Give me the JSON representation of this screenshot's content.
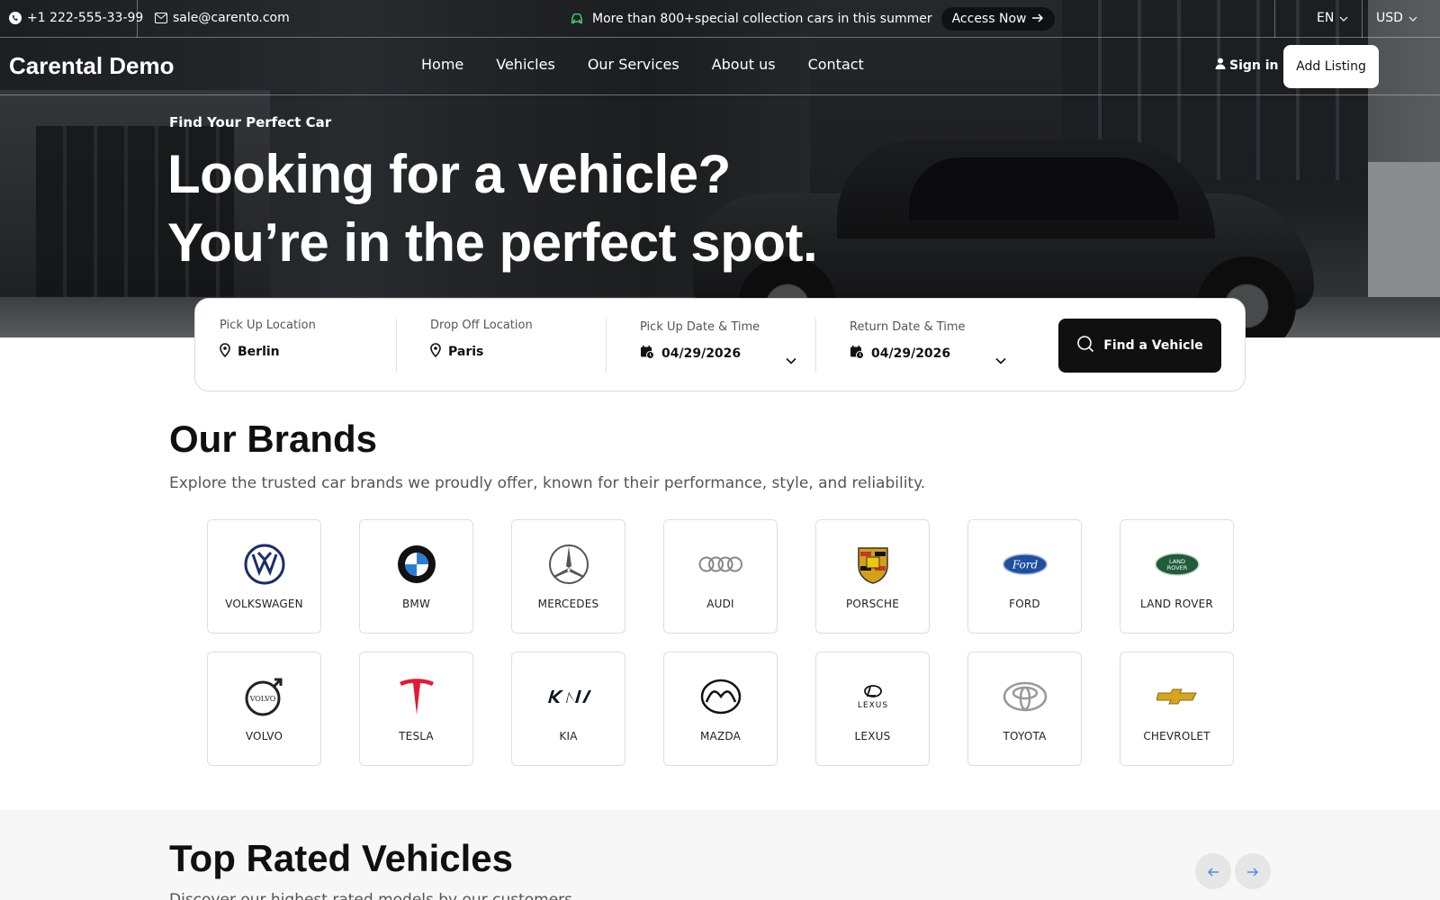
{
  "topbar": {
    "phone": "+1 222-555-33-99",
    "email": "sale@carento.com",
    "promo_text": "More than 800+special collection cars in this summer",
    "access_label": "Access Now",
    "language": "EN",
    "currency": "USD"
  },
  "nav": {
    "logo": "Carental Demo",
    "menu": [
      "Home",
      "Vehicles",
      "Our Services",
      "About us",
      "Contact"
    ],
    "sign_in": "Sign in",
    "add_listing": "Add Listing"
  },
  "hero": {
    "subtitle": "Find Your Perfect Car",
    "title_line1": "Looking for a vehicle?",
    "title_line2": "You’re in the perfect spot."
  },
  "search": {
    "pickup_label": "Pick Up Location",
    "pickup_value": "Berlin",
    "dropoff_label": "Drop Off Location",
    "dropoff_value": "Paris",
    "pickup_date_label": "Pick Up Date & Time",
    "pickup_date_value": "04/29/2026",
    "return_date_label": "Return Date & Time",
    "return_date_value": "04/29/2026",
    "find_label": "Find a Vehicle"
  },
  "brands": {
    "title": "Our Brands",
    "description": "Explore the trusted car brands we proudly offer, known for their performance, style, and reliability.",
    "items": [
      {
        "name": "VOLKSWAGEN",
        "icon": "volkswagen-logo"
      },
      {
        "name": "BMW",
        "icon": "bmw-logo"
      },
      {
        "name": "MERCEDES",
        "icon": "mercedes-logo"
      },
      {
        "name": "AUDI",
        "icon": "audi-logo"
      },
      {
        "name": "PORSCHE",
        "icon": "porsche-logo"
      },
      {
        "name": "FORD",
        "icon": "ford-logo"
      },
      {
        "name": "LAND ROVER",
        "icon": "land-rover-logo"
      },
      {
        "name": "VOLVO",
        "icon": "volvo-logo"
      },
      {
        "name": "TESLA",
        "icon": "tesla-logo"
      },
      {
        "name": "KIA",
        "icon": "kia-logo"
      },
      {
        "name": "MAZDA",
        "icon": "mazda-logo"
      },
      {
        "name": "LEXUS",
        "icon": "lexus-logo"
      },
      {
        "name": "TOYOTA",
        "icon": "toyota-logo"
      },
      {
        "name": "CHEVROLET",
        "icon": "chevrolet-logo"
      }
    ]
  },
  "top_rated": {
    "title": "Top Rated Vehicles",
    "description": "Discover our highest rated models by our customers"
  },
  "colors": {
    "accent": "#101010",
    "promo_icon": "#4ade80",
    "arrow": "#4a8fe0"
  }
}
